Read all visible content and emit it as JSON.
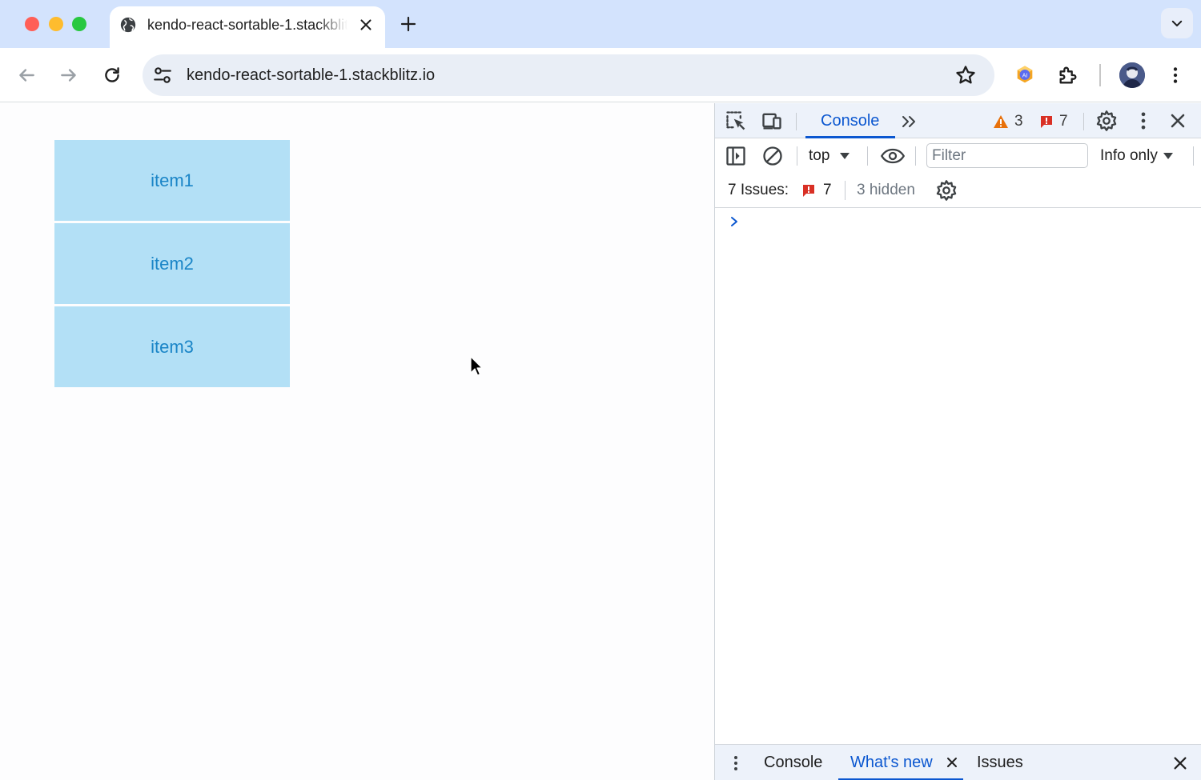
{
  "browser": {
    "tab": {
      "title": "kendo-react-sortable-1.stackblitz.io",
      "favicon": "globe-icon"
    },
    "url": "kendo-react-sortable-1.stackblitz.io",
    "colors": {
      "tabstrip": "#d3e3fd",
      "omnibox": "#e9eef6"
    }
  },
  "page": {
    "sortable_items": [
      {
        "label": "item1"
      },
      {
        "label": "item2"
      },
      {
        "label": "item3"
      }
    ],
    "colors": {
      "item_bg": "#b3e0f6",
      "item_text": "#1a85c7"
    }
  },
  "devtools": {
    "active_tab": "Console",
    "warnings_count": "3",
    "errors_count": "7",
    "context": "top",
    "filter_placeholder": "Filter",
    "log_level": "Info only",
    "issues_label": "7 Issues:",
    "issues_count": "7",
    "hidden_label": "3 hidden",
    "drawer": {
      "tabs": [
        {
          "label": "Console"
        },
        {
          "label": "What's new"
        },
        {
          "label": "Issues"
        }
      ],
      "active": "What's new"
    },
    "colors": {
      "accent": "#0b57d0",
      "warning": "#e8710a",
      "error": "#d93025"
    }
  }
}
